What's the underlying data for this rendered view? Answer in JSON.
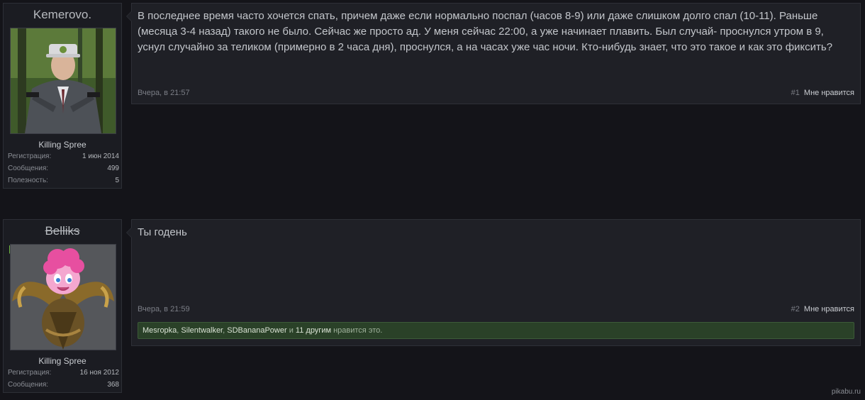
{
  "posts": [
    {
      "username": "Kemerovo.",
      "user_title": "Killing Spree",
      "stats": [
        {
          "label": "Регистрация:",
          "value": "1 июн 2014"
        },
        {
          "label": "Сообщения:",
          "value": "499"
        },
        {
          "label": "Полезность:",
          "value": "5"
        }
      ],
      "message": "В последнее время часто хочется спать, причем даже если нормально поспал (часов 8-9) или даже слишком долго спал (10-11). Раньше (месяца 3-4 назад) такого не было. Сейчас же просто ад. У меня сейчас 22:00, а уже начинает плавить. Был случай- проснулся утром в 9, уснул случайно за теликом (примерно в 2 часа дня), проснулся, а на часах уже час ночи. Кто-нибудь знает, что это такое и как это фиксить?",
      "date": "Вчера, в 21:57",
      "post_number": "#1",
      "like_label": "Мне нравится"
    },
    {
      "username": "Belliks",
      "user_title": "Killing Spree",
      "stats": [
        {
          "label": "Регистрация:",
          "value": "16 ноя 2012"
        },
        {
          "label": "Сообщения:",
          "value": "368"
        }
      ],
      "message": "Ты годень",
      "date": "Вчера, в 21:59",
      "post_number": "#2",
      "like_label": "Мне нравится",
      "likes": {
        "names": [
          "Mesropka",
          "Silentwalker",
          "SDBananaPower"
        ],
        "sep": ",",
        "and": "и",
        "others": "11 другим",
        "suffix": "нравится это."
      }
    }
  ],
  "watermark": "pikabu.ru",
  "colors": {
    "background": "#141419",
    "likes_bg": "#2a4128",
    "online_marker": "#6db33f"
  }
}
